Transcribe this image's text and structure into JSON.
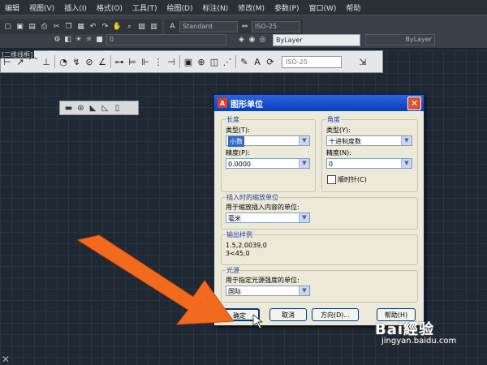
{
  "menubar": {
    "items": [
      "编辑",
      "视图(V)",
      "插入(I)",
      "格式(O)",
      "工具(T)",
      "绘图(D)",
      "标注(N)",
      "修改(M)",
      "参数(P)",
      "窗口(W)",
      "帮助"
    ]
  },
  "toolbar": {
    "text_style": "Standard",
    "dim_style": "ISO-25",
    "layer_value": "0",
    "color_value": "ByLayer",
    "linetype_value": "ByLayer"
  },
  "workspace_label": "[二维线框]",
  "dim_toolbar": {
    "style_value": "ISO-25"
  },
  "dialog": {
    "title": "图形单位",
    "length": {
      "group_label": "长度",
      "type_label": "类型(T):",
      "type_value": "小数",
      "precision_label": "精度(P):",
      "precision_value": "0.0000"
    },
    "angle": {
      "group_label": "角度",
      "type_label": "类型(Y):",
      "type_value": "十进制度数",
      "precision_label": "精度(N):",
      "precision_value": "0",
      "clockwise_label": "顺时针(C)"
    },
    "insert_scale": {
      "group_label": "插入时的缩放单位",
      "desc": "用于缩放插入内容的单位:",
      "value": "毫米"
    },
    "sample": {
      "group_label": "输出样例",
      "line1": "1.5,2.0039,0",
      "line2": "3<45,0"
    },
    "lighting": {
      "group_label": "光源",
      "desc": "用于指定光源强度的单位:",
      "value": "国际"
    },
    "buttons": {
      "ok": "确定",
      "cancel": "取消",
      "direction": "方向(D)...",
      "help": "帮助(H)"
    }
  },
  "watermark": {
    "brand": "Bai經验",
    "url": "jingyan.baidu.com"
  },
  "colors": {
    "arrow": "#f26a1e",
    "title_bar": "#0a3fbf"
  }
}
